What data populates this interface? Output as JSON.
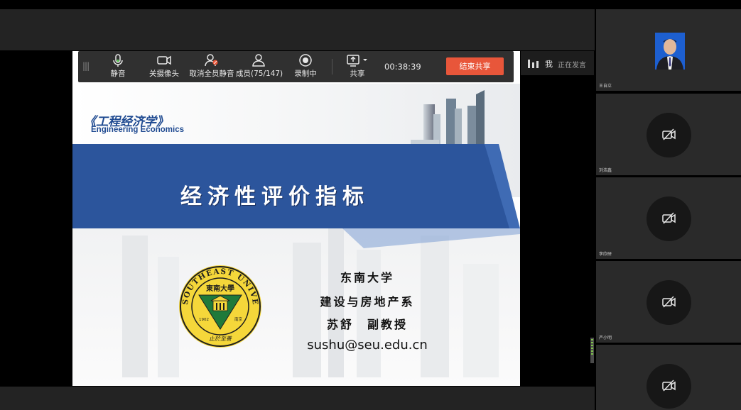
{
  "toolbar": {
    "items": [
      {
        "label": "静音",
        "icon": "microphone-icon"
      },
      {
        "label": "关摄像头",
        "icon": "camera-icon"
      },
      {
        "label": "取消全员静音",
        "icon": "unmute-all-icon"
      },
      {
        "label": "成员(75/147)",
        "icon": "members-icon"
      },
      {
        "label": "录制中",
        "icon": "record-icon"
      },
      {
        "label": "共享",
        "icon": "share-icon"
      }
    ],
    "timer": "00:38:39",
    "end_share": "结束共享",
    "accent": "#e8563a"
  },
  "speaking": {
    "me": "我",
    "status": "正在发言"
  },
  "slide": {
    "course_title": "《工程经济学》",
    "course_subtitle": "Engineering Economics",
    "main_title": "经济性评价指标",
    "university": "东南大学",
    "department": "建设与房地产系",
    "author": "苏舒　副教授",
    "email": "sushu@seu.edu.cn",
    "logo_text": "SOUTHEAST UNIVERSITY",
    "logo_cn": "東南大學",
    "logo_year": "1902",
    "logo_city": "南京",
    "logo_motto": "止於至善",
    "banner_color": "#2c559c"
  },
  "participants": [
    {
      "name": "王自立",
      "video": true
    },
    {
      "name": "刘浩鑫",
      "video": false
    },
    {
      "name": "李欣研",
      "video": false
    },
    {
      "name": "严小明",
      "video": false
    },
    {
      "name": "",
      "video": false
    }
  ]
}
